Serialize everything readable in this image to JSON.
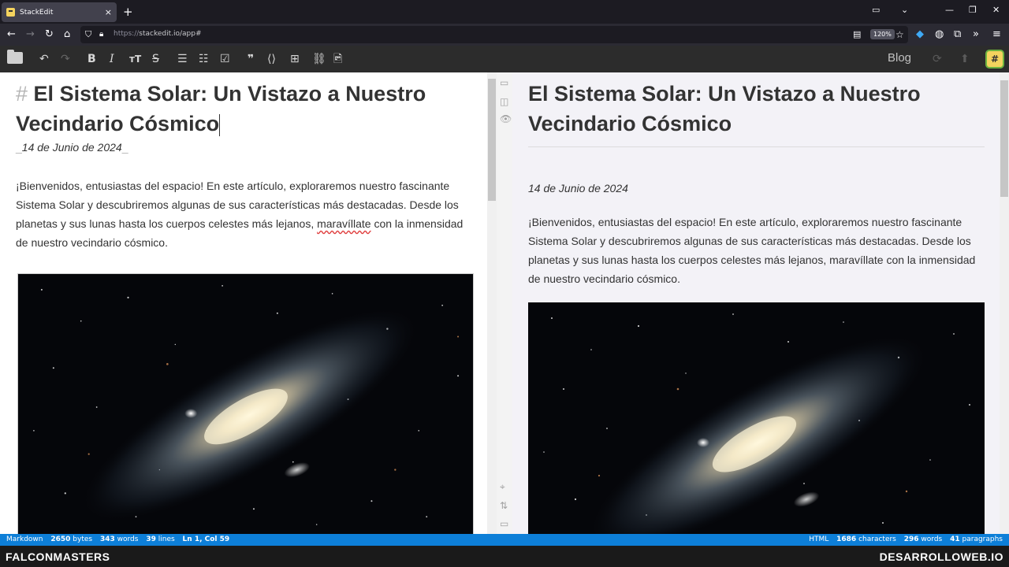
{
  "browser": {
    "tab_title": "StackEdit",
    "tab_close": "×",
    "new_tab": "+",
    "url_protocol": "https://",
    "url_rest": "stackedit.io/app#",
    "zoom": "120%"
  },
  "toolbar": {
    "blog_label": "Blog",
    "badge": "#"
  },
  "editor": {
    "heading_marker": "#",
    "heading_first": "El",
    "heading_rest": " Sistema Solar: Un Vistazo a Nuestro Vecindario Cósmico",
    "date_marker": "_",
    "date": "14 de Junio de 2024",
    "para_before": "¡Bienvenidos, entusiastas del espacio! En este artículo, exploraremos nuestro fascinante Sistema Solar y descubriremos algunas de sus características más destacadas. Desde los planetas y sus lunas hasta los cuerpos celestes más lejanos, ",
    "para_misspelled": "maravíllate",
    "para_after": " con la inmensidad de nuestro vecindario cósmico."
  },
  "preview": {
    "heading": "El Sistema Solar: Un Vistazo a Nuestro Vecindario Cósmico",
    "date": "14 de Junio de 2024",
    "paragraph": "¡Bienvenidos, entusiastas del espacio! En este artículo, exploraremos nuestro fascinante Sistema Solar y descubriremos algunas de sus características más destacadas. Desde los planetas y sus lunas hasta los cuerpos celestes más lejanos, maravíllate con la inmensidad de nuestro vecindario cósmico."
  },
  "status": {
    "left_label": "Markdown",
    "bytes": "2650",
    "bytes_label": "bytes",
    "words": "343",
    "words_label": "words",
    "lines": "39",
    "lines_label": "lines",
    "cursor": "Ln 1, Col 59",
    "right_label": "HTML",
    "characters": "1686",
    "characters_label": "characters",
    "html_words": "296",
    "html_words_label": "words",
    "paragraphs": "41",
    "paragraphs_label": "paragraphs"
  },
  "watermark": {
    "left": "FALCONMASTERS",
    "right": "DESARROLLOWEB.IO"
  },
  "colors": {
    "status_bar": "#0d7fd8",
    "toolbar": "#2c2c2c",
    "preview_bg": "#f3f2f7"
  }
}
